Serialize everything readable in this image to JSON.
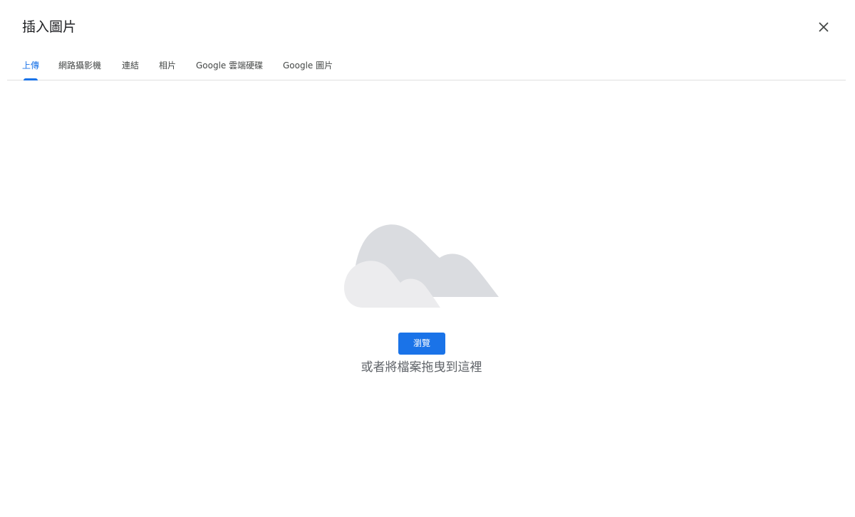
{
  "dialog": {
    "title": "插入圖片",
    "close_icon": "close-icon"
  },
  "tabs": [
    {
      "label": "上傳",
      "active": true
    },
    {
      "label": "網路攝影機",
      "active": false
    },
    {
      "label": "連結",
      "active": false
    },
    {
      "label": "相片",
      "active": false
    },
    {
      "label": "Google 雲端硬碟",
      "active": false
    },
    {
      "label": "Google 圖片",
      "active": false
    }
  ],
  "upload": {
    "illustration_icon": "cloud-icon",
    "browse_label": "瀏覽",
    "drag_hint": "或者將檔案拖曳到這裡"
  },
  "colors": {
    "accent": "#1a73e8",
    "cloud_back": "#dadce0",
    "cloud_front": "#ececee"
  }
}
